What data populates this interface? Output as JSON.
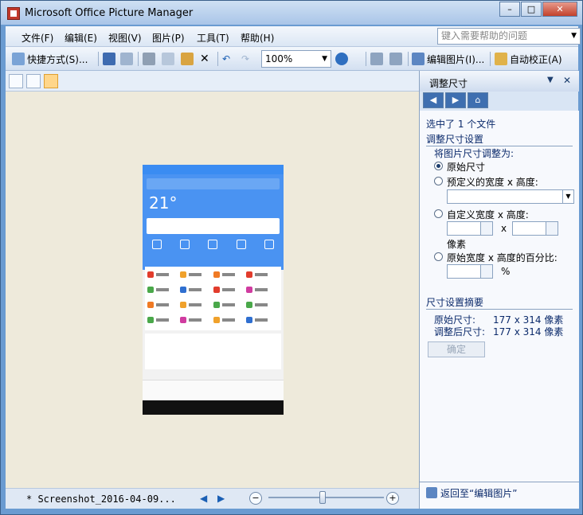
{
  "window": {
    "title": "Microsoft Office Picture Manager",
    "min": "–",
    "max": "□",
    "close": "✕"
  },
  "menu": [
    "文件(F)",
    "编辑(E)",
    "视图(V)",
    "图片(P)",
    "工具(T)",
    "帮助(H)"
  ],
  "help_placeholder": "键入需要帮助的问题",
  "toolbar": {
    "shortcut_label": "快捷方式(S)...",
    "zoom": "100%",
    "edit_label": "编辑图片(I)...",
    "autofix_label": "自动校正(A)"
  },
  "status": {
    "filename": "* Screenshot_2016-04-09..."
  },
  "phone": {
    "temp": "21°"
  },
  "pane": {
    "title": "调整尺寸",
    "selected": "选中了 1 个文件",
    "settings_heading": "调整尺寸设置",
    "resize_to": "将图片尺寸调整为:",
    "opt_original": "原始尺寸",
    "opt_predefined": "预定义的宽度 x 高度:",
    "opt_custom": "自定义宽度 x 高度:",
    "x": "x",
    "pixels": "像素",
    "opt_percent": "原始宽度 x 高度的百分比:",
    "percent_sign": "%",
    "summary_heading": "尺寸设置摘要",
    "orig_size_label": "原始尺寸:",
    "orig_size": "177 x 314 像素",
    "new_size_label": "调整后尺寸:",
    "new_size": "177 x 314 像素",
    "ok": "确定",
    "back": "返回至“编辑图片”"
  },
  "colors": {
    "accent": "#4a93f2",
    "pane_text": "#0b2a6b"
  }
}
